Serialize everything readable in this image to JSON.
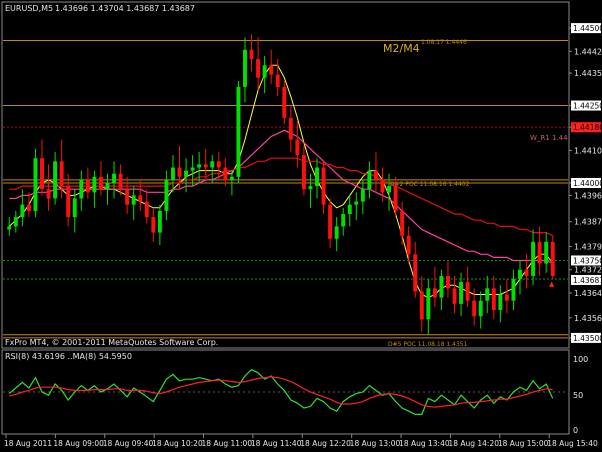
{
  "header": {
    "symbol_text": "EURUSD,M5",
    "ohlc_text": "1.43696 1.43704 1.43687 1.43687"
  },
  "price_axis": {
    "ticks": [
      "1.44500",
      "1.44425",
      "1.44355",
      "1.44250",
      "1.44180",
      "1.44105",
      "1.44000",
      "1.43960",
      "1.43875",
      "1.43795",
      "1.43720",
      "1.43645",
      "1.43565",
      "1.43500"
    ],
    "boxed": [
      {
        "key": "1.44500",
        "text": "1.44500",
        "bg": "#ffffff",
        "fg": "#000000"
      },
      {
        "key": "1.44250",
        "text": "1.44250",
        "bg": "#ffffff",
        "fg": "#000000"
      },
      {
        "key": "1.44180",
        "text": "1.44180",
        "bg": "#ff2020",
        "fg": "#000000"
      },
      {
        "key": "1.44000",
        "text": "1.44000",
        "bg": "#ffffff",
        "fg": "#000000"
      },
      {
        "key": "1.43750",
        "text": "1.43750",
        "bg": "#ffffff",
        "fg": "#000000"
      },
      {
        "key": "1.43687",
        "text": "1.43687",
        "bg": "#ffffff",
        "fg": "#000000"
      },
      {
        "key": "1.43500",
        "text": "1.43500",
        "bg": "#ffffff",
        "fg": "#000000"
      }
    ]
  },
  "annotations": {
    "m2m4": "M2/M4",
    "top_level_label": "1.08.17 1.4446",
    "wr1": "W_R1 1.44",
    "dpoc_mid": "D#2 POC 11.08.16 1.4402",
    "dpoc_low": "D#5 POC 11.08.18 1.4351"
  },
  "rsi": {
    "title": "RSI(8) 43.6196 ..MA(8) 54.5950",
    "levels": [
      "100",
      "50",
      "0"
    ]
  },
  "footer": {
    "copyright": "FxPro MT4, © 2001-2011 MetaQuotes Software Corp."
  },
  "time_axis": {
    "labels": [
      "18 Aug 2011",
      "18 Aug 09:00",
      "18 Aug 09:40",
      "18 Aug 10:20",
      "18 Aug 11:00",
      "18 Aug 11:40",
      "18 Aug 12:20",
      "18 Aug 13:00",
      "18 Aug 13:40",
      "18 Aug 14:20",
      "18 Aug 15:00",
      "18 Aug 15:40"
    ]
  },
  "colors": {
    "bull": "#00e000",
    "bear": "#ff1010",
    "fast_ma": "#ffff40",
    "mid_ma": "#ff40a0",
    "slow_ma": "#e01010",
    "rsi_line": "#30e030",
    "rsi_ma": "#ff2020",
    "level_gold": "#c08a10",
    "level_green": "#00a000",
    "level_red": "#b00010",
    "axis_text": "#e6e6e6"
  },
  "chart_data": {
    "type": "candlestick",
    "symbol": "EURUSD",
    "timeframe": "M5",
    "ylim": [
      1.4349,
      1.4451
    ],
    "last_price": 1.43687,
    "levels": [
      1.4446,
      1.4425,
      1.4418,
      1.4401,
      1.44,
      1.4375,
      1.4369,
      1.4351,
      1.435
    ],
    "candles": [
      [
        1.4385,
        1.4389,
        1.4383,
        1.4386
      ],
      [
        1.4386,
        1.4391,
        1.4384,
        1.4389
      ],
      [
        1.4389,
        1.4398,
        1.4386,
        1.4393
      ],
      [
        1.4393,
        1.4397,
        1.4389,
        1.4391
      ],
      [
        1.4391,
        1.4411,
        1.4389,
        1.4408
      ],
      [
        1.4408,
        1.4414,
        1.4396,
        1.4398
      ],
      [
        1.4398,
        1.4406,
        1.4391,
        1.4395
      ],
      [
        1.4395,
        1.441,
        1.4393,
        1.4407
      ],
      [
        1.4407,
        1.4414,
        1.4395,
        1.4399
      ],
      [
        1.4399,
        1.4403,
        1.4386,
        1.4389
      ],
      [
        1.4389,
        1.4398,
        1.4384,
        1.4395
      ],
      [
        1.4395,
        1.4404,
        1.4391,
        1.4401
      ],
      [
        1.4401,
        1.4405,
        1.4395,
        1.4397
      ],
      [
        1.4397,
        1.4404,
        1.4392,
        1.4402
      ],
      [
        1.4402,
        1.4407,
        1.4396,
        1.4398
      ],
      [
        1.4398,
        1.4403,
        1.4393,
        1.44
      ],
      [
        1.44,
        1.4407,
        1.4395,
        1.4403
      ],
      [
        1.4403,
        1.4406,
        1.4396,
        1.4398
      ],
      [
        1.4398,
        1.4402,
        1.439,
        1.4393
      ],
      [
        1.4393,
        1.4399,
        1.4388,
        1.4396
      ],
      [
        1.4396,
        1.4401,
        1.4391,
        1.4394
      ],
      [
        1.4394,
        1.4398,
        1.4387,
        1.4389
      ],
      [
        1.4389,
        1.4392,
        1.4381,
        1.4384
      ],
      [
        1.4384,
        1.4393,
        1.438,
        1.4391
      ],
      [
        1.4391,
        1.4404,
        1.4388,
        1.4401
      ],
      [
        1.4401,
        1.4409,
        1.4397,
        1.4405
      ],
      [
        1.4405,
        1.4412,
        1.4398,
        1.4402
      ],
      [
        1.4402,
        1.4408,
        1.4397,
        1.4404
      ],
      [
        1.4404,
        1.4409,
        1.4399,
        1.4405
      ],
      [
        1.4405,
        1.441,
        1.44,
        1.4406
      ],
      [
        1.4406,
        1.4411,
        1.4401,
        1.4405
      ],
      [
        1.4405,
        1.4409,
        1.44,
        1.4407
      ],
      [
        1.4407,
        1.441,
        1.4401,
        1.4405
      ],
      [
        1.4405,
        1.4408,
        1.4399,
        1.4401
      ],
      [
        1.4401,
        1.4404,
        1.4396,
        1.4402
      ],
      [
        1.4402,
        1.4433,
        1.44,
        1.4431
      ],
      [
        1.4431,
        1.4447,
        1.4426,
        1.4443
      ],
      [
        1.4443,
        1.4448,
        1.4436,
        1.444
      ],
      [
        1.444,
        1.4447,
        1.443,
        1.4434
      ],
      [
        1.4434,
        1.4441,
        1.4429,
        1.4438
      ],
      [
        1.4438,
        1.4443,
        1.4432,
        1.4435
      ],
      [
        1.4435,
        1.444,
        1.4428,
        1.4431
      ],
      [
        1.4431,
        1.4433,
        1.4419,
        1.4421
      ],
      [
        1.4421,
        1.4425,
        1.441,
        1.4414
      ],
      [
        1.4414,
        1.442,
        1.4405,
        1.4409
      ],
      [
        1.4409,
        1.4412,
        1.4396,
        1.4398
      ],
      [
        1.4398,
        1.4403,
        1.4392,
        1.4399
      ],
      [
        1.4399,
        1.4408,
        1.4395,
        1.4405
      ],
      [
        1.4405,
        1.4407,
        1.439,
        1.4393
      ],
      [
        1.4393,
        1.4395,
        1.4379,
        1.4382
      ],
      [
        1.4382,
        1.4389,
        1.4378,
        1.4386
      ],
      [
        1.4386,
        1.4392,
        1.4383,
        1.439
      ],
      [
        1.439,
        1.4396,
        1.4386,
        1.4393
      ],
      [
        1.4393,
        1.4397,
        1.4388,
        1.4394
      ],
      [
        1.4394,
        1.4401,
        1.439,
        1.4398
      ],
      [
        1.4398,
        1.4407,
        1.4395,
        1.4404
      ],
      [
        1.4404,
        1.441,
        1.4397,
        1.4401
      ],
      [
        1.4401,
        1.4405,
        1.4394,
        1.4397
      ],
      [
        1.4397,
        1.4403,
        1.4391,
        1.4399
      ],
      [
        1.4399,
        1.4402,
        1.4389,
        1.4391
      ],
      [
        1.4391,
        1.4394,
        1.438,
        1.4383
      ],
      [
        1.4383,
        1.4386,
        1.4374,
        1.4377
      ],
      [
        1.4377,
        1.4381,
        1.4363,
        1.4365
      ],
      [
        1.4365,
        1.437,
        1.4352,
        1.4356
      ],
      [
        1.4356,
        1.4369,
        1.4351,
        1.4366
      ],
      [
        1.4366,
        1.4373,
        1.436,
        1.4363
      ],
      [
        1.4363,
        1.4372,
        1.4359,
        1.437
      ],
      [
        1.437,
        1.4375,
        1.4363,
        1.4366
      ],
      [
        1.4366,
        1.437,
        1.4358,
        1.4361
      ],
      [
        1.4361,
        1.4371,
        1.4357,
        1.4368
      ],
      [
        1.4368,
        1.4373,
        1.436,
        1.4362
      ],
      [
        1.4362,
        1.4366,
        1.4354,
        1.4357
      ],
      [
        1.4357,
        1.4365,
        1.4353,
        1.4362
      ],
      [
        1.4362,
        1.437,
        1.4358,
        1.4366
      ],
      [
        1.4366,
        1.437,
        1.4356,
        1.4359
      ],
      [
        1.4359,
        1.4367,
        1.4355,
        1.4364
      ],
      [
        1.4364,
        1.4369,
        1.4358,
        1.4362
      ],
      [
        1.4362,
        1.4372,
        1.4359,
        1.4369
      ],
      [
        1.4369,
        1.4375,
        1.4364,
        1.4372
      ],
      [
        1.4372,
        1.4377,
        1.4366,
        1.437
      ],
      [
        1.437,
        1.4385,
        1.4367,
        1.4381
      ],
      [
        1.4381,
        1.4386,
        1.437,
        1.4374
      ],
      [
        1.4374,
        1.4384,
        1.4371,
        1.4381
      ],
      [
        1.4381,
        1.4383,
        1.4369,
        1.437
      ]
    ],
    "series": [
      {
        "name": "fast MA",
        "color": "#ffff40",
        "values": [
          1.4386,
          1.4388,
          1.439,
          1.4393,
          1.4397,
          1.44,
          1.4401,
          1.44,
          1.4398,
          1.4396,
          1.4396,
          1.4397,
          1.4398,
          1.4399,
          1.4399,
          1.4398,
          1.4398,
          1.4397,
          1.4396,
          1.4395,
          1.4394,
          1.4393,
          1.4392,
          1.4392,
          1.4395,
          1.4398,
          1.44,
          1.4402,
          1.4403,
          1.4404,
          1.4404,
          1.4404,
          1.4404,
          1.4403,
          1.4403,
          1.4407,
          1.4414,
          1.4422,
          1.443,
          1.4435,
          1.4438,
          1.4438,
          1.4434,
          1.4428,
          1.4421,
          1.4413,
          1.4406,
          1.4401,
          1.4397,
          1.4394,
          1.4392,
          1.4393,
          1.4396,
          1.4399,
          1.4402,
          1.4404,
          1.4404,
          1.4401,
          1.4396,
          1.439,
          1.4383,
          1.4375,
          1.4368,
          1.4364,
          1.4363,
          1.4364,
          1.4366,
          1.4367,
          1.4367,
          1.4366,
          1.4365,
          1.4364,
          1.4364,
          1.4364,
          1.4364,
          1.4364,
          1.4365,
          1.4366,
          1.4369,
          1.4372,
          1.4375,
          1.4377,
          1.4377,
          1.4374
        ]
      },
      {
        "name": "mid MA",
        "color": "#ff40a0",
        "values": [
          1.4395,
          1.4395,
          1.4396,
          1.4396,
          1.4397,
          1.4397,
          1.4397,
          1.4398,
          1.4398,
          1.4398,
          1.4398,
          1.4398,
          1.4398,
          1.4398,
          1.4398,
          1.4398,
          1.4398,
          1.4398,
          1.4398,
          1.4398,
          1.4398,
          1.4397,
          1.4397,
          1.4397,
          1.4397,
          1.4398,
          1.4398,
          1.4399,
          1.4399,
          1.44,
          1.4401,
          1.4401,
          1.4402,
          1.4403,
          1.4404,
          1.4405,
          1.4407,
          1.4409,
          1.4411,
          1.4413,
          1.4415,
          1.4416,
          1.4417,
          1.4416,
          1.4415,
          1.4413,
          1.4411,
          1.4409,
          1.4407,
          1.4405,
          1.4403,
          1.4401,
          1.44,
          1.4399,
          1.4398,
          1.4398,
          1.4397,
          1.4396,
          1.4395,
          1.4393,
          1.4391,
          1.4389,
          1.4387,
          1.4385,
          1.4384,
          1.4383,
          1.4382,
          1.4381,
          1.438,
          1.4379,
          1.4378,
          1.4378,
          1.4377,
          1.4377,
          1.4376,
          1.4376,
          1.4376,
          1.4375,
          1.4375,
          1.4375,
          1.4375,
          1.4375,
          1.4375,
          1.4374
        ]
      },
      {
        "name": "slow MA",
        "color": "#e01010",
        "values": [
          1.4398,
          1.4398,
          1.4399,
          1.4399,
          1.4399,
          1.4399,
          1.4399,
          1.4399,
          1.4399,
          1.4399,
          1.4399,
          1.4399,
          1.4399,
          1.4399,
          1.4399,
          1.4399,
          1.4399,
          1.4399,
          1.4399,
          1.4399,
          1.4399,
          1.4399,
          1.4399,
          1.4399,
          1.4399,
          1.44,
          1.44,
          1.4401,
          1.4401,
          1.4402,
          1.4402,
          1.4403,
          1.4403,
          1.4404,
          1.4404,
          1.4405,
          1.4405,
          1.4406,
          1.4407,
          1.4407,
          1.4408,
          1.4408,
          1.4408,
          1.4408,
          1.4408,
          1.4407,
          1.4407,
          1.4407,
          1.4406,
          1.4406,
          1.4405,
          1.4405,
          1.4404,
          1.4404,
          1.4403,
          1.4403,
          1.4402,
          1.4401,
          1.44,
          1.4399,
          1.4398,
          1.4397,
          1.4396,
          1.4395,
          1.4394,
          1.4393,
          1.4392,
          1.4391,
          1.439,
          1.439,
          1.4389,
          1.4388,
          1.4388,
          1.4387,
          1.4387,
          1.4386,
          1.4386,
          1.4386,
          1.4385,
          1.4385,
          1.4384,
          1.4384,
          1.4384,
          1.4383
        ]
      }
    ],
    "rsi_values": [
      48,
      55,
      62,
      55,
      68,
      50,
      46,
      60,
      52,
      40,
      50,
      58,
      52,
      58,
      50,
      54,
      60,
      52,
      44,
      55,
      50,
      44,
      38,
      52,
      66,
      72,
      64,
      66,
      66,
      68,
      66,
      64,
      66,
      60,
      56,
      58,
      70,
      78,
      74,
      66,
      70,
      60,
      52,
      40,
      36,
      30,
      32,
      42,
      38,
      30,
      26,
      38,
      44,
      48,
      50,
      58,
      52,
      46,
      48,
      38,
      30,
      26,
      22,
      22,
      42,
      38,
      46,
      40,
      34,
      46,
      38,
      30,
      40,
      46,
      36,
      44,
      40,
      50,
      56,
      52,
      64,
      54,
      60,
      42
    ],
    "rsi_ma_values": [
      45,
      47,
      50,
      52,
      55,
      56,
      56,
      56,
      55,
      53,
      52,
      52,
      52,
      53,
      53,
      53,
      54,
      54,
      52,
      52,
      52,
      51,
      49,
      48,
      50,
      53,
      56,
      58,
      60,
      62,
      63,
      64,
      65,
      64,
      63,
      62,
      63,
      65,
      67,
      68,
      69,
      68,
      66,
      63,
      59,
      54,
      50,
      47,
      44,
      41,
      37,
      35,
      35,
      36,
      38,
      42,
      45,
      47,
      48,
      47,
      45,
      42,
      38,
      34,
      32,
      31,
      32,
      33,
      34,
      36,
      37,
      37,
      38,
      39,
      40,
      41,
      41,
      43,
      45,
      47,
      50,
      52,
      54,
      53
    ],
    "rsi_ylim": [
      0,
      100
    ]
  }
}
